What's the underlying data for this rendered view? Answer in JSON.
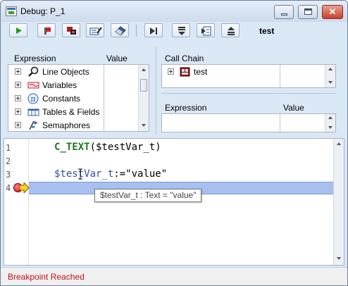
{
  "window": {
    "title": "Debug: P_1"
  },
  "toolbar": {
    "buttons": [
      {
        "name": "run-icon",
        "color": "#1d9e1d"
      },
      {
        "name": "stop-icon",
        "color": "#d41a1a"
      },
      {
        "name": "abort-icon",
        "color": "#b01c1c"
      },
      {
        "name": "edit-icon",
        "color": "#2a4f8f"
      },
      {
        "name": "eraser-icon",
        "color": "#3b5f91"
      },
      {
        "name": "step-over-icon",
        "color": "#333333"
      },
      {
        "name": "step-into-icon",
        "color": "#333333"
      },
      {
        "name": "trace-icon",
        "color": "#2a4f8f"
      },
      {
        "name": "step-out-icon",
        "color": "#333333"
      }
    ],
    "method_label": "test"
  },
  "left_pane": {
    "col_expression": "Expression",
    "col_value": "Value",
    "items": [
      {
        "label": "Line Objects",
        "icon": "magnifier-icon"
      },
      {
        "label": "Variables",
        "icon": "variables-icon"
      },
      {
        "label": "Constants",
        "icon": "pi-icon"
      },
      {
        "label": "Tables & Fields",
        "icon": "table-fields-icon"
      },
      {
        "label": "Semaphores",
        "icon": "semaphore-icon"
      }
    ]
  },
  "call_chain": {
    "header": "Call Chain",
    "items": [
      {
        "label": "test",
        "icon": "method-icon"
      }
    ]
  },
  "watch_pane": {
    "col_expression": "Expression",
    "col_value": "Value"
  },
  "editor": {
    "lines": [
      {
        "number": "1",
        "code_kw": "C_TEXT",
        "code_rest": "($testVar_t)"
      },
      {
        "number": "2"
      },
      {
        "number": "3",
        "code_var": "$testVar_t",
        "code_rest": ":=\"value\""
      },
      {
        "number": "4"
      }
    ],
    "tooltip": "$testVar_t : Text = \"value\""
  },
  "status": {
    "text": "Breakpoint Reached",
    "color": "#c0141a"
  },
  "colors": {
    "accent": "#dae7f5",
    "highlight": "#a7c0ef",
    "keyword": "#1f7a1f",
    "variable": "#2c4fb0"
  }
}
